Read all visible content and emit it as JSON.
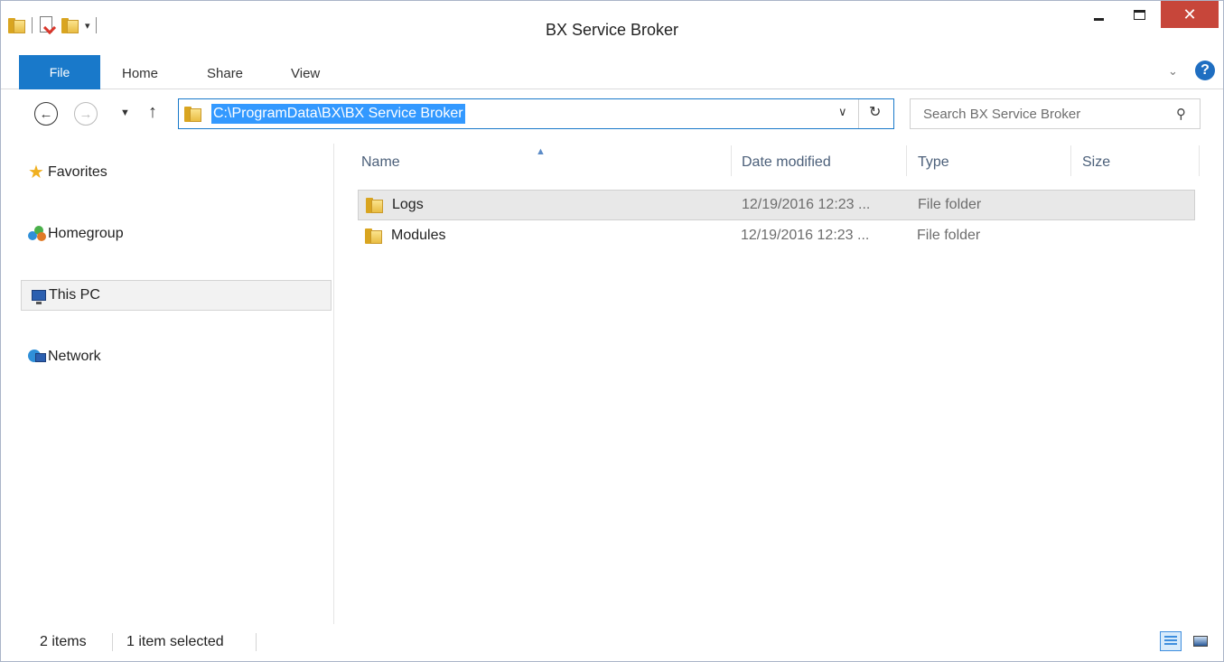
{
  "window": {
    "title": "BX Service Broker",
    "close_glyph": "✕",
    "accent_color": "#1979ca",
    "close_color": "#c7463a"
  },
  "quick_access": {
    "dropdown_glyph": "▾"
  },
  "ribbon": {
    "tabs": [
      {
        "label": "File"
      },
      {
        "label": "Home"
      },
      {
        "label": "Share"
      },
      {
        "label": "View"
      }
    ],
    "expand_glyph": "⌄",
    "help_glyph": "?"
  },
  "navigation": {
    "back_glyph": "←",
    "forward_glyph": "→",
    "recent_glyph": "▼",
    "up_glyph": "↑",
    "address": "C:\\ProgramData\\BX\\BX Service Broker",
    "address_dropdown_glyph": "∨",
    "refresh_glyph": "↻",
    "search_placeholder": "Search BX Service Broker",
    "search_glyph": "⚲"
  },
  "nav_pane": {
    "items": [
      {
        "label": "Favorites",
        "icon": "star-icon"
      },
      {
        "label": "Homegroup",
        "icon": "homegroup-icon"
      },
      {
        "label": "This PC",
        "icon": "computer-icon",
        "selected": true
      },
      {
        "label": "Network",
        "icon": "network-icon"
      }
    ]
  },
  "file_list": {
    "sort_glyph": "▲",
    "columns": [
      "Name",
      "Date modified",
      "Type",
      "Size"
    ],
    "rows": [
      {
        "name": "Logs",
        "date": "12/19/2016 12:23 ...",
        "type": "File folder",
        "size": "",
        "selected": true
      },
      {
        "name": "Modules",
        "date": "12/19/2016 12:23 ...",
        "type": "File folder",
        "size": "",
        "selected": false
      }
    ]
  },
  "status": {
    "item_count": "2 items",
    "selection": "1 item selected"
  }
}
